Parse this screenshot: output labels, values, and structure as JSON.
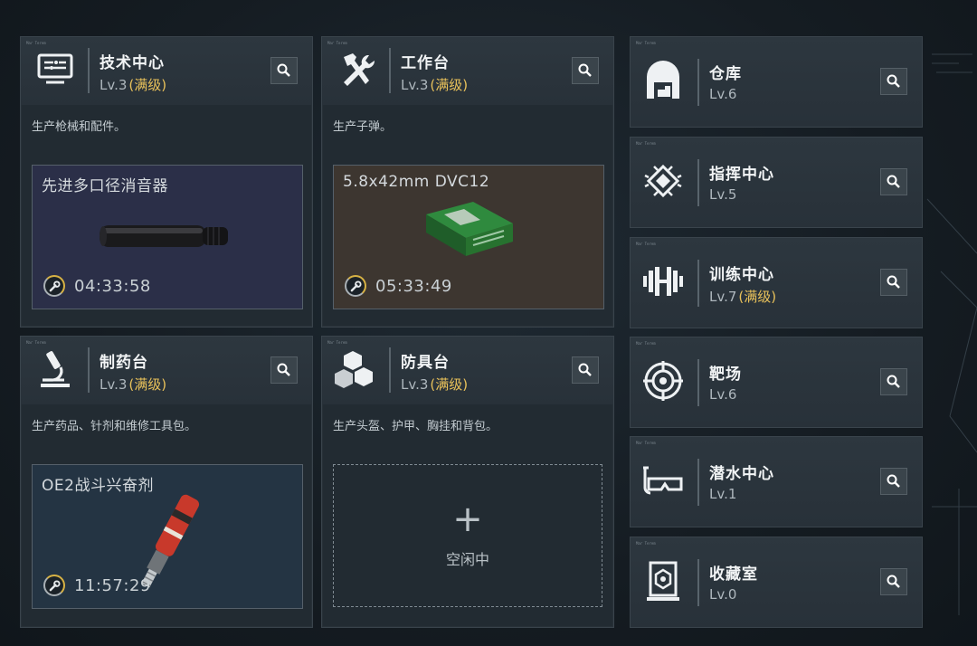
{
  "workstations": [
    {
      "title": "技术中心",
      "level": "Lv.3",
      "max_label": "(满级)",
      "description": "生产枪械和配件。",
      "crafting": {
        "item": "先进多口径消音器",
        "timer": "04:33:58",
        "bg": "#2b2f48"
      }
    },
    {
      "title": "工作台",
      "level": "Lv.3",
      "max_label": "(满级)",
      "description": "生产子弹。",
      "crafting": {
        "item": "5.8x42mm DVC12",
        "timer": "05:33:49",
        "bg": "#3d3630"
      }
    },
    {
      "title": "制药台",
      "level": "Lv.3",
      "max_label": "(满级)",
      "description": "生产药品、针剂和维修工具包。",
      "crafting": {
        "item": "OE2战斗兴奋剂",
        "timer": "11:57:29",
        "bg": "#243443"
      }
    },
    {
      "title": "防具台",
      "level": "Lv.3",
      "max_label": "(满级)",
      "description": "生产头盔、护甲、胸挂和背包。",
      "idle": {
        "plus": "+",
        "label": "空闲中"
      }
    }
  ],
  "facilities": [
    {
      "title": "仓库",
      "level": "Lv.6",
      "max_label": "",
      "icon": "warehouse-icon"
    },
    {
      "title": "指挥中心",
      "level": "Lv.5",
      "max_label": "",
      "icon": "chip-icon"
    },
    {
      "title": "训练中心",
      "level": "Lv.7",
      "max_label": "(满级)",
      "icon": "dumbbell-icon"
    },
    {
      "title": "靶场",
      "level": "Lv.6",
      "max_label": "",
      "icon": "target-icon"
    },
    {
      "title": "潜水中心",
      "level": "Lv.1",
      "max_label": "",
      "icon": "diving-mask-icon"
    },
    {
      "title": "收藏室",
      "level": "Lv.0",
      "max_label": "",
      "icon": "display-case-icon"
    }
  ],
  "accent_color": "#e8c15a"
}
